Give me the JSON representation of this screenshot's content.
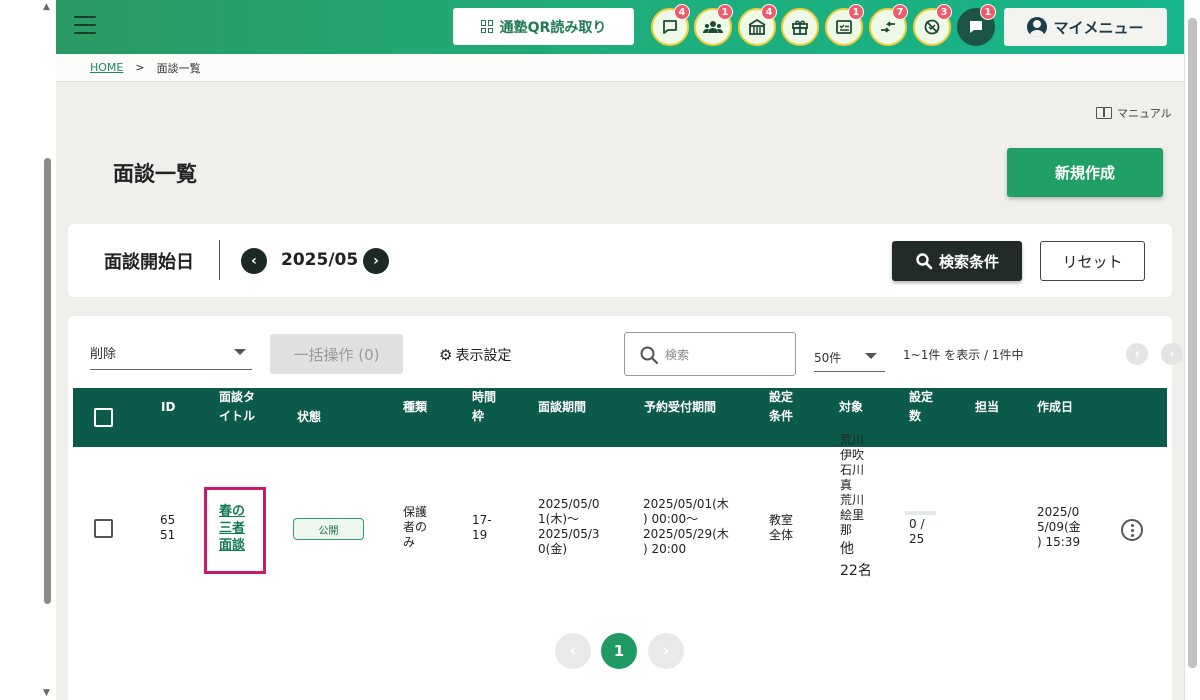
{
  "header": {
    "qr_button_label": "通塾QR読み取り",
    "icons": [
      {
        "name": "message-icon",
        "badge": "4"
      },
      {
        "name": "users-icon",
        "badge": "1"
      },
      {
        "name": "school-icon",
        "badge": "4"
      },
      {
        "name": "gift-icon",
        "badge": ""
      },
      {
        "name": "checklist-icon",
        "badge": "1"
      },
      {
        "name": "transfer-icon",
        "badge": "7"
      },
      {
        "name": "no-attendance-icon",
        "badge": "3"
      },
      {
        "name": "chat-icon",
        "badge": "1"
      }
    ],
    "my_menu_label": "マイメニュー"
  },
  "breadcrumb": {
    "home": "HOME",
    "separator": ">",
    "current": "面談一覧"
  },
  "manual_label": "マニュアル",
  "page_title": "面談一覧",
  "new_button_label": "新規作成",
  "filter": {
    "date_label": "面談開始日",
    "prev_glyph": "‹",
    "next_glyph": "›",
    "month": "2025/05",
    "search_button_label": "検索条件",
    "reset_button_label": "リセット"
  },
  "toolbar": {
    "delete_select_value": "削除",
    "bulk_button_label": "一括操作 (0)",
    "display_settings_label": "表示設定",
    "search_placeholder": "検索",
    "per_page_value": "50件",
    "count_text": "1~1件 を表示 / 1件中",
    "prev_glyph": "‹",
    "next_glyph": "›"
  },
  "table": {
    "headers": {
      "id": "ID",
      "title_line1": "面談タ",
      "title_line2": "イトル",
      "status": "状態",
      "type": "種類",
      "slot_line1": "時間",
      "slot_line2": "枠",
      "period": "面談期間",
      "reservation": "予約受付期間",
      "cond_line1": "設定",
      "cond_line2": "条件",
      "target": "対象",
      "count_line1": "設定",
      "count_line2": "数",
      "owner": "担当",
      "created": "作成日"
    },
    "rows": [
      {
        "id_line1": "65",
        "id_line2": "51",
        "title_line1": "春の",
        "title_line2": "三者",
        "title_line3": "面談",
        "status": "公開",
        "type_line1": "保護",
        "type_line2": "者の",
        "type_line3": "み",
        "slot_line1": "17-",
        "slot_line2": "19",
        "period_line1": "2025/05/0",
        "period_line2": "1(木)〜",
        "period_line3": "2025/05/3",
        "period_line4": "0(金)",
        "reservation_line1": "2025/05/01(木",
        "reservation_line2": ") 00:00〜",
        "reservation_line3": "2025/05/29(木",
        "reservation_line4": ") 20:00",
        "cond_line1": "教室",
        "cond_line2": "全体",
        "target_line1": "荒川",
        "target_line2": "伊吹",
        "target_line3": "石川",
        "target_line4": "真",
        "target_line5": "荒川",
        "target_line6": "絵里",
        "target_line7": "那",
        "target_line8": "他",
        "target_line9": "22名",
        "count_line1": "0 /",
        "count_line2": "25",
        "count_progress": 0,
        "owner": "",
        "created_line1": "2025/0",
        "created_line2": "5/09(金",
        "created_line3": ") 15:39"
      }
    ]
  },
  "pagination": {
    "prev_glyph": "‹",
    "current": "1",
    "next_glyph": "›"
  },
  "colors": {
    "header_green": "#1eaf7d",
    "table_header": "#0c5a4c",
    "primary_button": "#21a065",
    "dark_button": "#232b28",
    "badge_red": "#f05a6c",
    "highlight_border": "#c8196b"
  }
}
